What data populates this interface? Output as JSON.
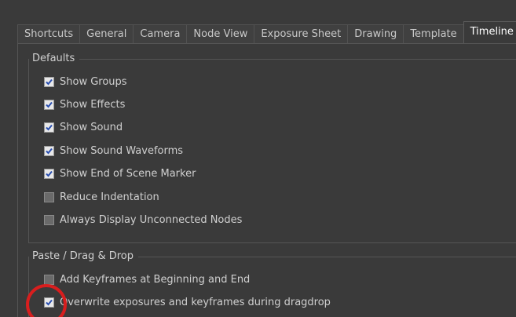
{
  "tabs": [
    {
      "label": "Shortcuts",
      "active": false
    },
    {
      "label": "General",
      "active": false
    },
    {
      "label": "Camera",
      "active": false
    },
    {
      "label": "Node View",
      "active": false
    },
    {
      "label": "Exposure Sheet",
      "active": false
    },
    {
      "label": "Drawing",
      "active": false
    },
    {
      "label": "Template",
      "active": false
    },
    {
      "label": "Timeline",
      "active": true
    }
  ],
  "defaults_group": {
    "title": "Defaults",
    "options": [
      {
        "label": "Show Groups",
        "checked": true
      },
      {
        "label": "Show Effects",
        "checked": true
      },
      {
        "label": "Show Sound",
        "checked": true
      },
      {
        "label": "Show Sound Waveforms",
        "checked": true
      },
      {
        "label": "Show End of Scene Marker",
        "checked": true
      },
      {
        "label": "Reduce Indentation",
        "checked": false
      },
      {
        "label": "Always Display Unconnected Nodes",
        "checked": false
      }
    ]
  },
  "paste_group": {
    "title": "Paste / Drag  & Drop",
    "options": [
      {
        "label": "Add Keyframes at Beginning and End",
        "checked": false
      },
      {
        "label": "Overwrite exposures and keyframes during dragdrop",
        "checked": true
      }
    ]
  },
  "annotation_color": "#d81e1e"
}
